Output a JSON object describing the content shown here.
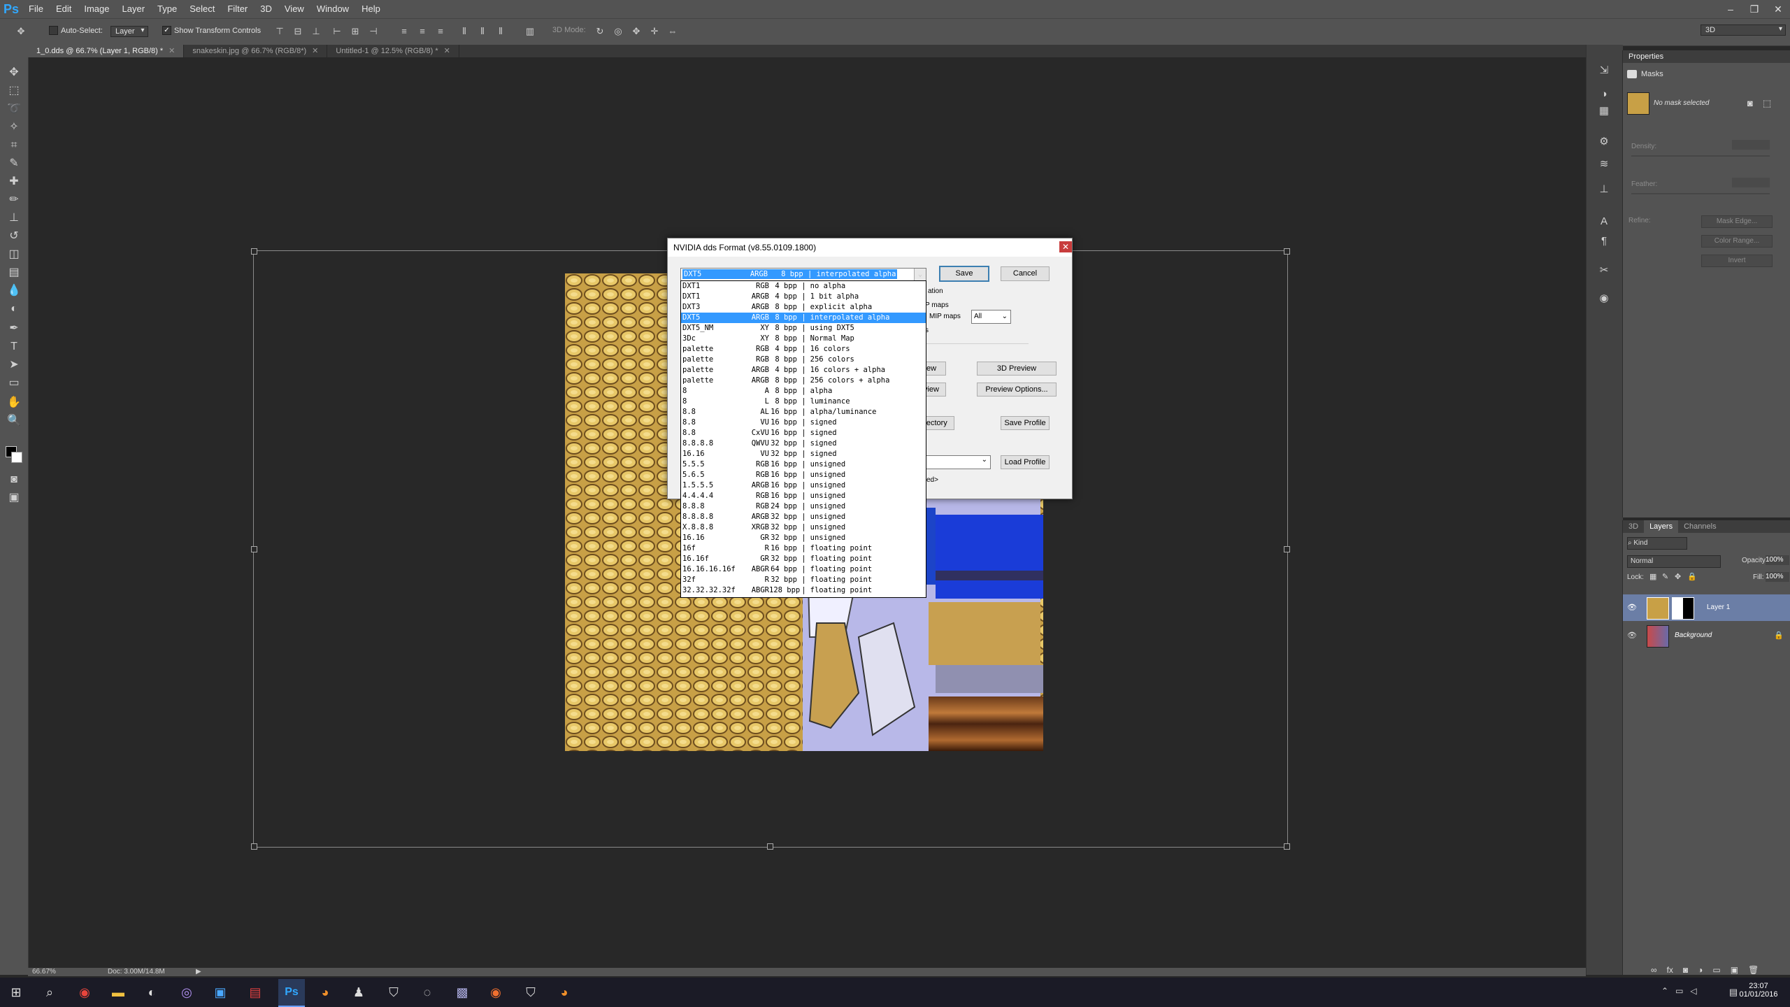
{
  "menubar": {
    "logo": "Ps",
    "items": [
      "File",
      "Edit",
      "Image",
      "Layer",
      "Type",
      "Select",
      "Filter",
      "3D",
      "View",
      "Window",
      "Help"
    ],
    "window_controls": [
      "–",
      "❐",
      "✕"
    ]
  },
  "options": {
    "auto_select_label": "Auto-Select:",
    "auto_select_value": "Layer",
    "show_transform_label": "Show Transform Controls",
    "mode_3d_label": "3D Mode:",
    "workspace": "3D"
  },
  "tabs": [
    {
      "label": "1_0.dds @ 66.7% (Layer 1, RGB/8) *"
    },
    {
      "label": "snakeskin.jpg @ 66.7% (RGB/8*)"
    },
    {
      "label": "Untitled-1 @ 12.5% (RGB/8) *"
    }
  ],
  "status": {
    "zoom": "66.67%",
    "doc": "Doc: 3.00M/14.8M"
  },
  "properties": {
    "tab": "Properties",
    "masks_label": "Masks",
    "no_mask": "No mask selected",
    "density": "Density:",
    "feather": "Feather:",
    "refine": "Refine:",
    "mask_edge": "Mask Edge...",
    "color_range": "Color Range...",
    "invert": "Invert"
  },
  "layers": {
    "tabs": [
      "3D",
      "Layers",
      "Channels"
    ],
    "kind": "Kind",
    "blend": "Normal",
    "opacity_label": "Opacity:",
    "opacity": "100%",
    "lock_label": "Lock:",
    "fill_label": "Fill:",
    "fill": "100%",
    "items": [
      {
        "name": "Layer 1"
      },
      {
        "name": "Background"
      }
    ]
  },
  "dialog": {
    "title": "NVIDIA dds Format (v8.55.0109.1800)",
    "close": "✕",
    "save": "Save",
    "cancel": "Cancel",
    "frag_ation": "ation",
    "frag_pmaps": "P maps",
    "mip_maps_label": "MIP maps",
    "mip_value": "All",
    "frag_s": "s",
    "frag_ew": "ew",
    "preview_3d": "3D Preview",
    "frag_view": "view",
    "preview_options": "Preview Options...",
    "frag_rectory": "rectory",
    "save_profile": "Save Profile",
    "load_profile": "Load Profile",
    "frag_ed": "ed>",
    "selected_format": "DXT5           ARGB   8 bpp | interpolated alpha",
    "formats": [
      [
        "DXT1",
        "RGB",
        "4 bpp",
        "no alpha"
      ],
      [
        "DXT1",
        "ARGB",
        "4 bpp",
        "1 bit alpha"
      ],
      [
        "DXT3",
        "ARGB",
        "8 bpp",
        "explicit alpha"
      ],
      [
        "DXT5",
        "ARGB",
        "8 bpp",
        "interpolated alpha"
      ],
      [
        "DXT5_NM",
        "XY",
        "8 bpp",
        "using DXT5"
      ],
      [
        "3Dc",
        "XY",
        "8 bpp",
        "Normal Map"
      ],
      [
        "palette",
        "RGB",
        "4 bpp",
        "16 colors"
      ],
      [
        "palette",
        "RGB",
        "8 bpp",
        "256 colors"
      ],
      [
        "palette",
        "ARGB",
        "4 bpp",
        "16 colors + alpha"
      ],
      [
        "palette",
        "ARGB",
        "8 bpp",
        "256 colors + alpha"
      ],
      [
        "8",
        "A",
        "8 bpp",
        "alpha"
      ],
      [
        "8",
        "L",
        "8 bpp",
        "luminance"
      ],
      [
        "8.8",
        "AL",
        "16 bpp",
        "alpha/luminance"
      ],
      [
        "8.8",
        "VU",
        "16 bpp",
        "signed"
      ],
      [
        "8.8",
        "CxVU",
        "16 bpp",
        "signed"
      ],
      [
        "8.8.8.8",
        "QWVU",
        "32 bpp",
        "signed"
      ],
      [
        "16.16",
        "VU",
        "32 bpp",
        "signed"
      ],
      [
        "5.5.5",
        "RGB",
        "16 bpp",
        "unsigned"
      ],
      [
        "5.6.5",
        "RGB",
        "16 bpp",
        "unsigned"
      ],
      [
        "1.5.5.5",
        "ARGB",
        "16 bpp",
        "unsigned"
      ],
      [
        "4.4.4.4",
        "RGB",
        "16 bpp",
        "unsigned"
      ],
      [
        "8.8.8",
        "RGB",
        "24 bpp",
        "unsigned"
      ],
      [
        "8.8.8.8",
        "ARGB",
        "32 bpp",
        "unsigned"
      ],
      [
        "X.8.8.8",
        "XRGB",
        "32 bpp",
        "unsigned"
      ],
      [
        "16.16",
        "GR",
        "32 bpp",
        "unsigned"
      ],
      [
        "16f",
        "R",
        "16 bpp",
        "floating point"
      ],
      [
        "16.16f",
        "GR",
        "32 bpp",
        "floating point"
      ],
      [
        "16.16.16.16f",
        "ABGR",
        "64 bpp",
        "floating point"
      ],
      [
        "32f",
        "R",
        "32 bpp",
        "floating point"
      ],
      [
        "32.32.32.32f",
        "ABGR",
        "128 bpp",
        "floating point"
      ]
    ],
    "selected_index": 3
  },
  "taskbar": {
    "time": "23:07",
    "date": "01/01/2016"
  },
  "colors": {
    "ui_dark": "#535353",
    "canvas_bg": "#282828",
    "selection_blue": "#3399ff",
    "ps_blue": "#31a8ff"
  }
}
